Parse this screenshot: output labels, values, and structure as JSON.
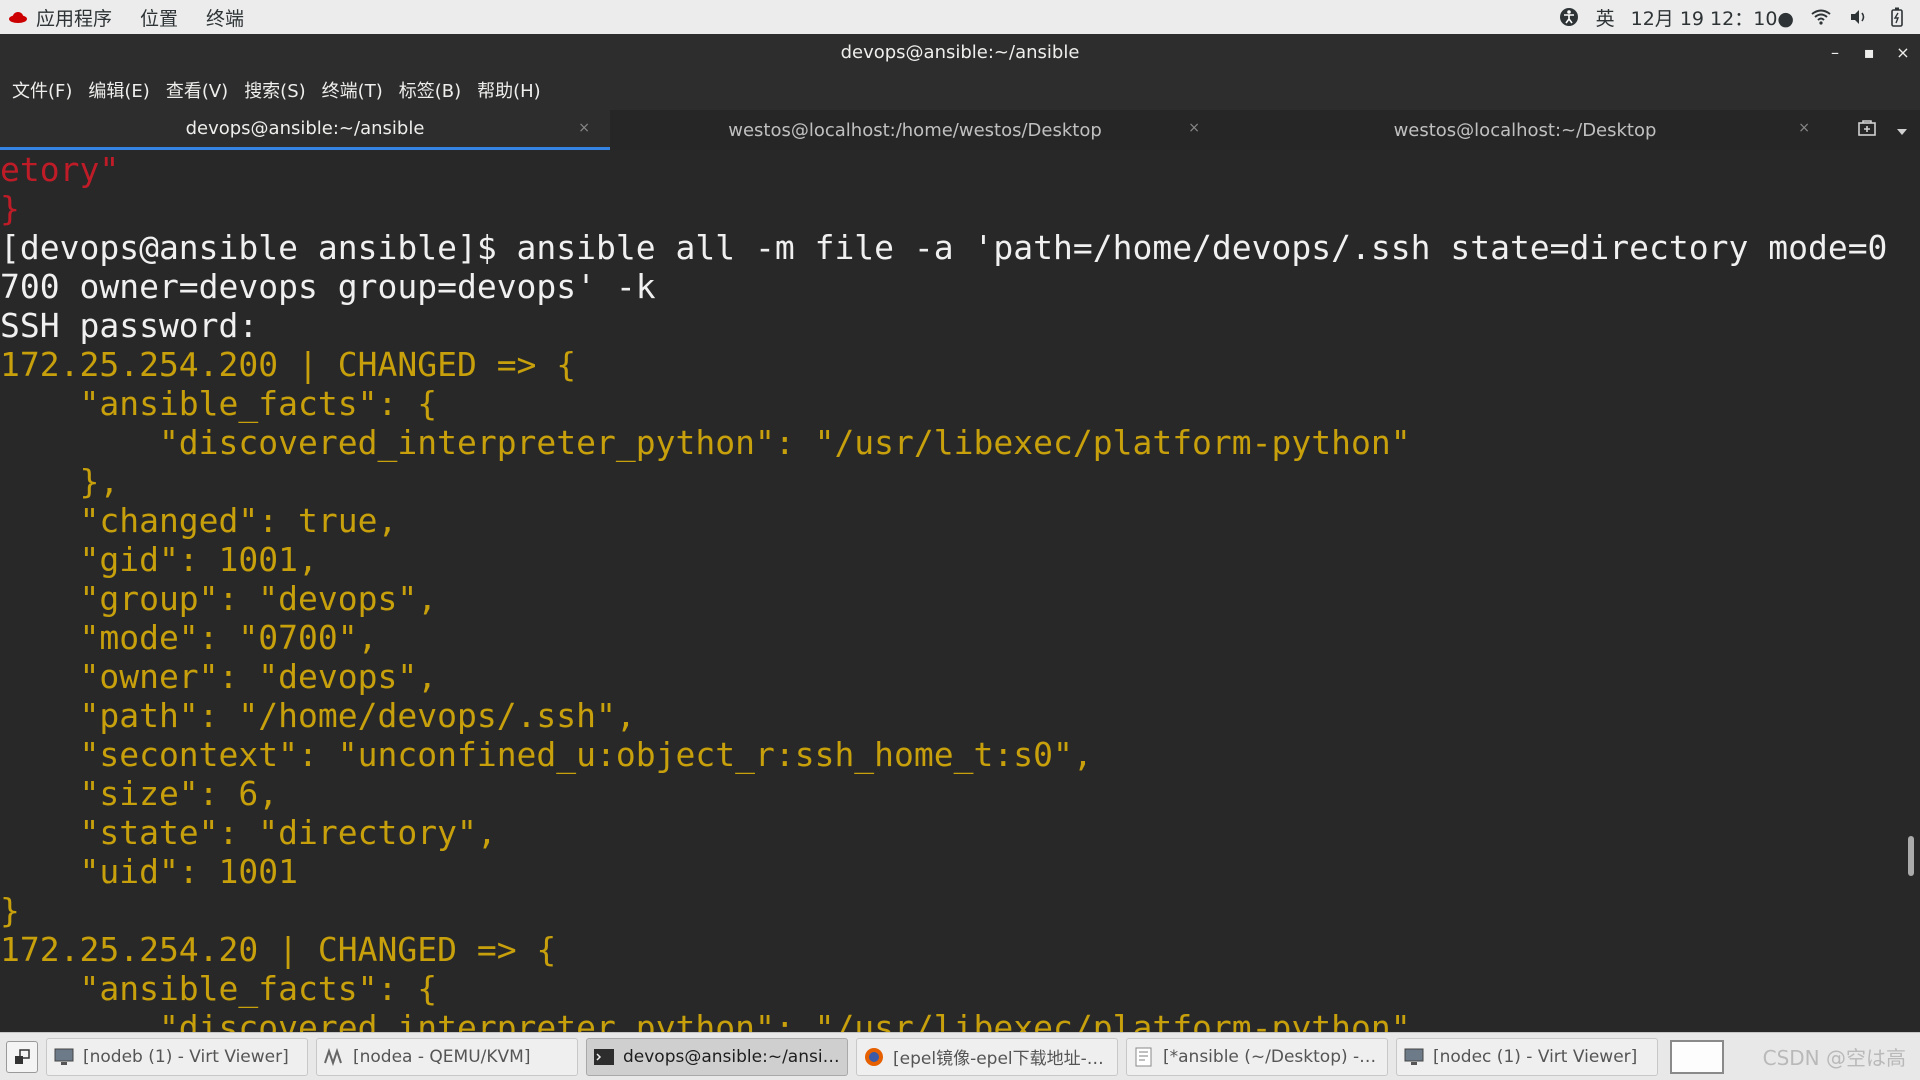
{
  "topbar": {
    "apps_label": "应用程序",
    "places_label": "位置",
    "terminal_label": "终端",
    "input_method": "英",
    "clock": "12月 19  12：10●"
  },
  "window": {
    "title": "devops@ansible:~/ansible",
    "minimize": "–",
    "maximize": "▪",
    "close": "×"
  },
  "menubar": {
    "items": [
      "文件(F)",
      "编辑(E)",
      "查看(V)",
      "搜索(S)",
      "终端(T)",
      "标签(B)",
      "帮助(H)"
    ]
  },
  "tabs": [
    {
      "label": "devops@ansible:~/ansible",
      "close": "×"
    },
    {
      "label": "westos@localhost:/home/westos/Desktop",
      "close": "×"
    },
    {
      "label": "westos@localhost:~/Desktop",
      "close": "×"
    }
  ],
  "terminal": {
    "lines": [
      "etory\"",
      "}",
      "[devops@ansible ansible]$ ansible all -m file -a 'path=/home/devops/.ssh state=directory mode=0",
      "700 owner=devops group=devops' -k",
      "SSH password:",
      "172.25.254.200 | CHANGED => {",
      "    \"ansible_facts\": {",
      "        \"discovered_interpreter_python\": \"/usr/libexec/platform-python\"",
      "    },",
      "    \"changed\": true,",
      "    \"gid\": 1001,",
      "    \"group\": \"devops\",",
      "    \"mode\": \"0700\",",
      "    \"owner\": \"devops\",",
      "    \"path\": \"/home/devops/.ssh\",",
      "    \"secontext\": \"unconfined_u:object_r:ssh_home_t:s0\",",
      "    \"size\": 6,",
      "    \"state\": \"directory\",",
      "    \"uid\": 1001",
      "}",
      "172.25.254.20 | CHANGED => {",
      "    \"ansible_facts\": {",
      "        \"discovered_interpreter_python\": \"/usr/libexec/platform-python\""
    ],
    "line_colors": [
      "red",
      "red",
      "white",
      "white",
      "white",
      "yellow",
      "yellow",
      "yellow",
      "yellow",
      "yellow",
      "yellow",
      "yellow",
      "yellow",
      "yellow",
      "yellow",
      "yellow",
      "yellow",
      "yellow",
      "yellow",
      "yellow",
      "yellow",
      "yellow",
      "yellow"
    ]
  },
  "taskbar": {
    "items": [
      {
        "label": "[nodeb (1) - Virt Viewer]",
        "icon": "monitor-icon",
        "active": false
      },
      {
        "label": "[nodea - QEMU/KVM]",
        "icon": "vm-icon",
        "active": false
      },
      {
        "label": "devops@ansible:~/ansible",
        "icon": "terminal-icon",
        "active": true
      },
      {
        "label": "[epel镜像-epel下载地址-epe…",
        "icon": "firefox-icon",
        "active": false
      },
      {
        "label": "[*ansible (~/Desktop) - gedit]",
        "icon": "gedit-icon",
        "active": false
      },
      {
        "label": "[nodec (1) - Virt Viewer]",
        "icon": "monitor-icon",
        "active": false
      }
    ],
    "watermark": "CSDN @空は高"
  },
  "colors": {
    "terminal_bg": "#282828",
    "prompt_white": "#f0f0f0",
    "output_yellow": "#c7a00c",
    "error_red": "#c01c28",
    "tab_accent": "#3584e4"
  }
}
